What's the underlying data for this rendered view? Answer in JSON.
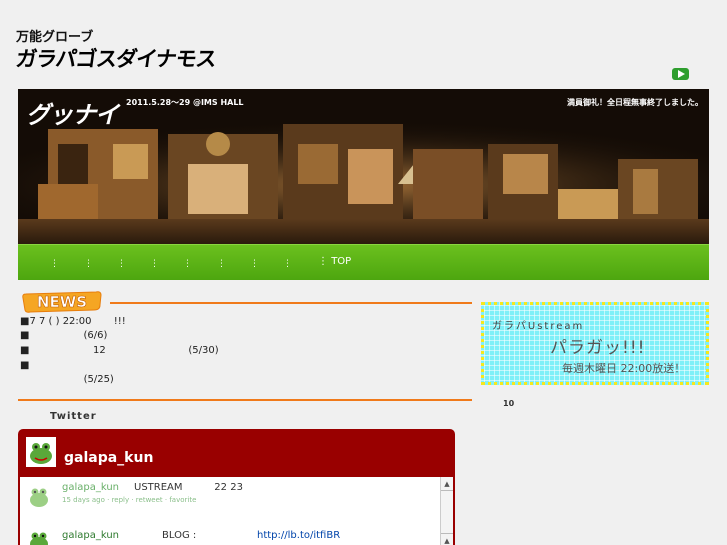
{
  "logo": {
    "top_line": "万能グローブ",
    "main_line": "ガラパゴスダイナモス"
  },
  "hero": {
    "title": "グッナイ",
    "date": "2011.5.28〜29 @IMS HALL",
    "note": "満員御礼！全日程無事終了しました。"
  },
  "nav": {
    "separator": "⋮",
    "top_label": "TOP"
  },
  "news": {
    "badge": "NEWS",
    "items": [
      "■7 7 ( ) 22:00       !!!",
      "■                 (6/6)",
      "■                    12                          (5/30)",
      "■",
      "                    (5/25)"
    ]
  },
  "twitter": {
    "label": "Twitter",
    "account": "galapa_kun",
    "tweets": [
      {
        "user": "galapa_kun",
        "text": "USTREAM          22 23",
        "meta": "15 days ago · reply · retweet · favorite"
      },
      {
        "user": "galapa_kun",
        "text": "BLOG :",
        "link": "http://lb.to/itfiBR"
      }
    ]
  },
  "sidebar": {
    "banner_line1": "ガラパUstream",
    "banner_line2": "パラガッ!!!",
    "banner_line3": "毎週木曜日 22:00放送！",
    "number": "10"
  },
  "colors": {
    "accent_orange": "#f07a1a",
    "nav_green": "#5cb318",
    "twitter_red": "#990000",
    "banner_cyan": "#7ff0f8",
    "banner_border": "#f7e81c"
  }
}
